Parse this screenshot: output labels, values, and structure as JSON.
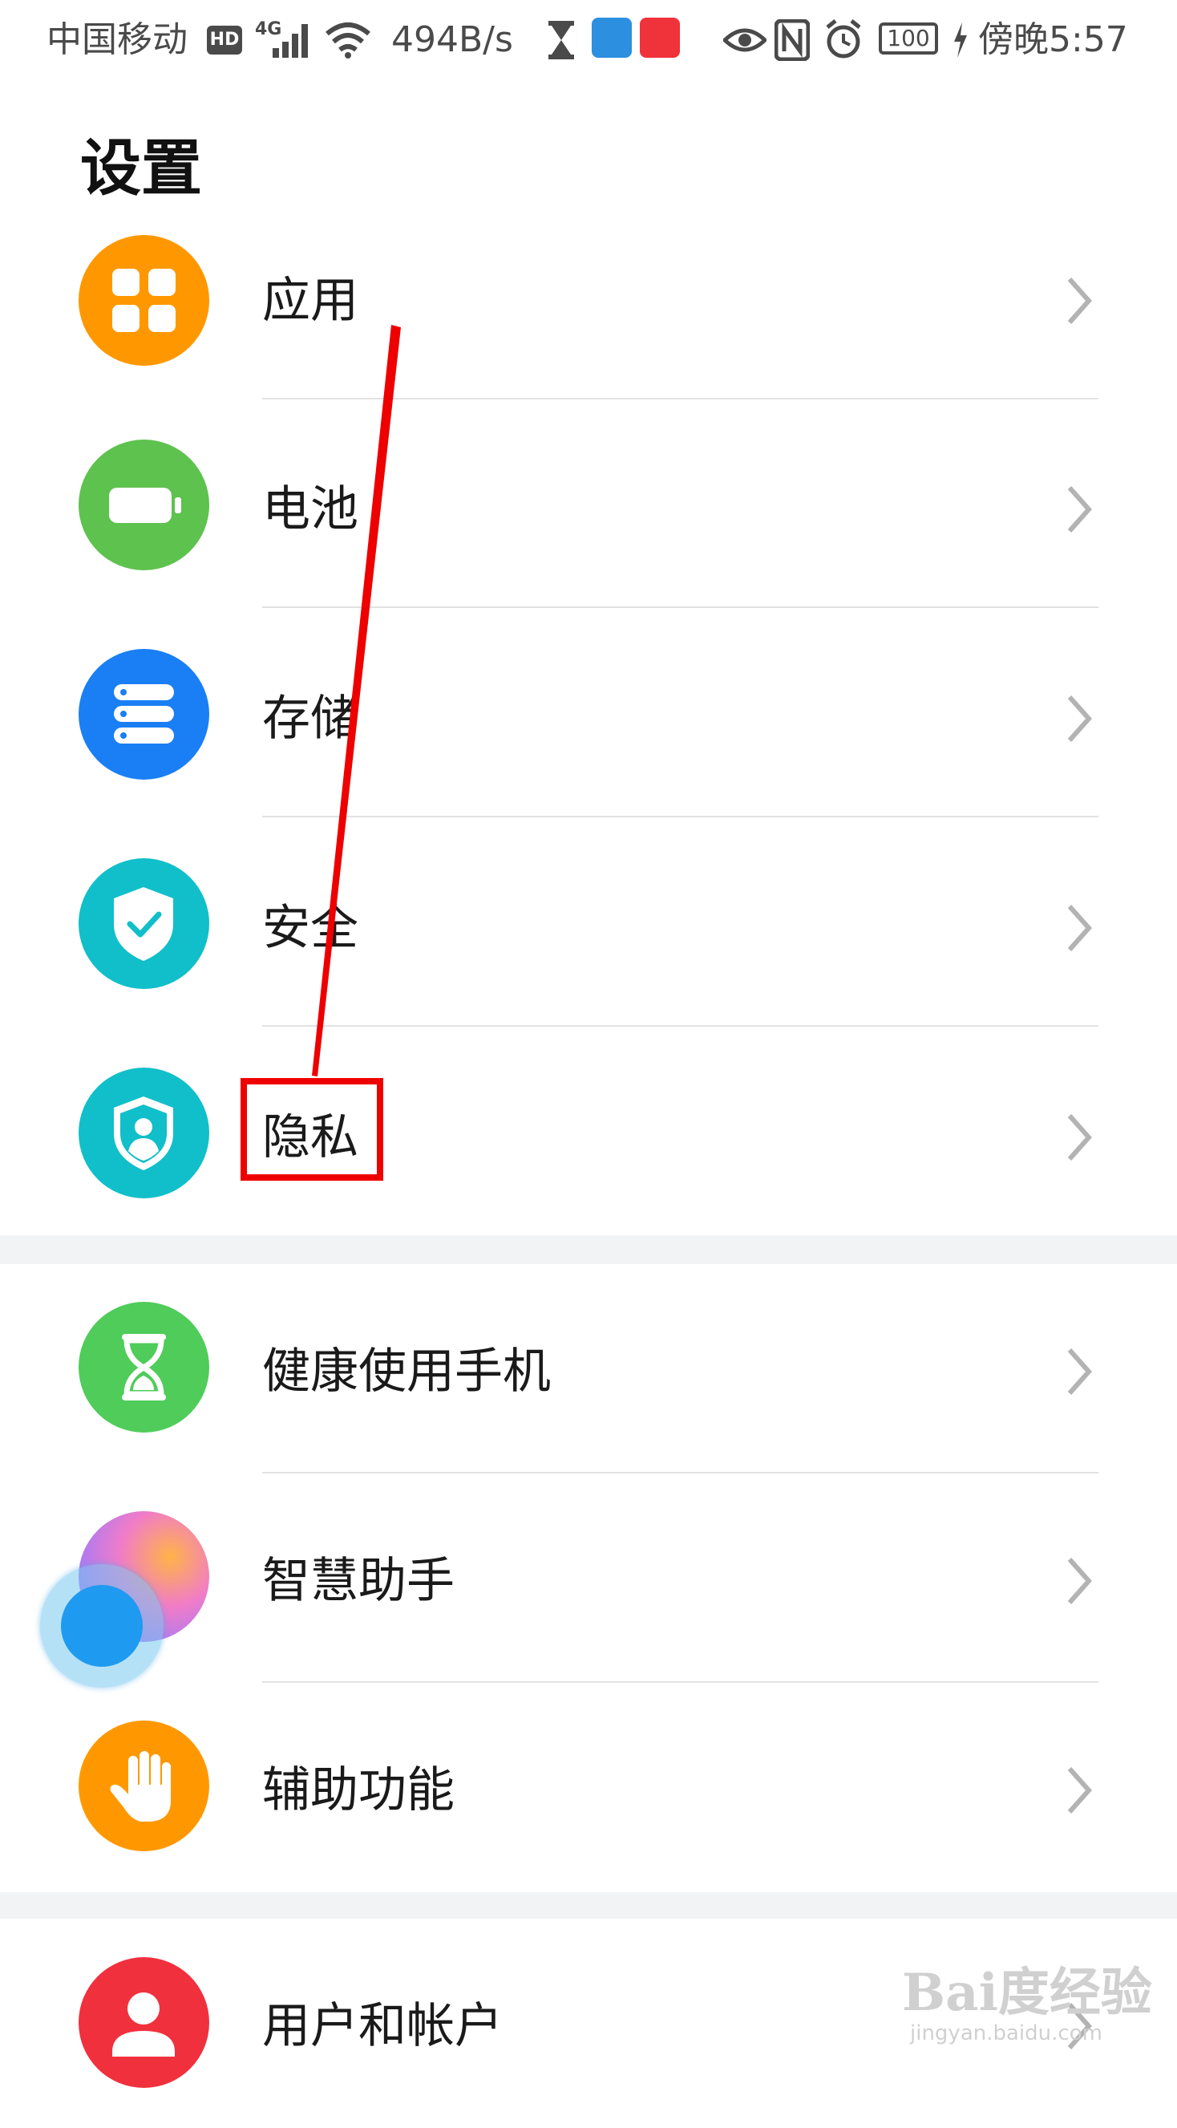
{
  "status_bar": {
    "carrier": "中国移动",
    "hd": "HD",
    "network": "4G",
    "speed": "494B/s",
    "battery": "100",
    "time": "傍晚5:57",
    "icons": [
      "signal-icon",
      "wifi-icon",
      "hourglass-icon",
      "app-notification-icon",
      "video-app-icon",
      "eye-icon",
      "nfc-icon",
      "alarm-icon",
      "battery-icon",
      "charging-icon"
    ]
  },
  "page": {
    "title": "设置"
  },
  "settings": {
    "group1": [
      {
        "label": "应用",
        "icon": "apps-icon",
        "color": "#ff9800"
      },
      {
        "label": "电池",
        "icon": "battery-icon",
        "color": "#5ec24e"
      },
      {
        "label": "存储",
        "icon": "storage-icon",
        "color": "#1a7ff4"
      },
      {
        "label": "安全",
        "icon": "security-shield-icon",
        "color": "#10bfc9"
      },
      {
        "label": "隐私",
        "icon": "privacy-icon",
        "color": "#10bfc9"
      }
    ],
    "group2": [
      {
        "label": "健康使用手机",
        "icon": "hourglass-icon",
        "color": "#4fcc5a"
      },
      {
        "label": "智慧助手",
        "icon": "assistant-icon",
        "color": "#e07cf0"
      },
      {
        "label": "辅助功能",
        "icon": "hand-icon",
        "color": "#ff9800"
      }
    ],
    "group3": [
      {
        "label": "用户和帐户",
        "icon": "user-icon",
        "color": "#f1303d"
      }
    ]
  },
  "watermark": {
    "logo": "Bai度经验",
    "url": "jingyan.baidu.com"
  },
  "annotation_color": "#ee0000"
}
